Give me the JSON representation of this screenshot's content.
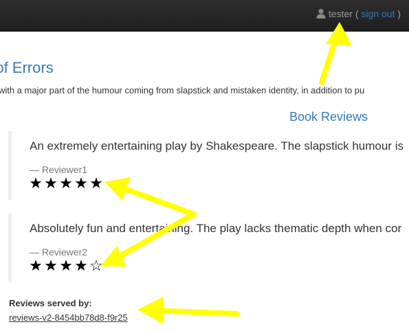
{
  "navbar": {
    "user_icon": "user-icon",
    "username": "tester",
    "open_paren": " ( ",
    "sign_out": "sign out",
    "close_paren": " )"
  },
  "product": {
    "title": "dy of Errors",
    "summary": "es, with a major part of the humour coming from slapstick and mistaken identity, in addition to pu"
  },
  "reviews_section": {
    "title": "Book Reviews",
    "reviews": [
      {
        "text": "An extremely entertaining play by Shakespeare. The slapstick humour is",
        "reviewer": "— Reviewer1",
        "rating": 5,
        "max": 5
      },
      {
        "text": "Absolutely fun and entertaining. The play lacks thematic depth when cor",
        "reviewer": "— Reviewer2",
        "rating": 4,
        "max": 5
      }
    ]
  },
  "served_by": {
    "label": "Reviews served by:",
    "value": "reviews-v2-8454bb78d8-f9r25"
  },
  "colors": {
    "navbar_bg": "#222222",
    "link": "#337ab7",
    "annotation_arrow": "#ffff00"
  }
}
